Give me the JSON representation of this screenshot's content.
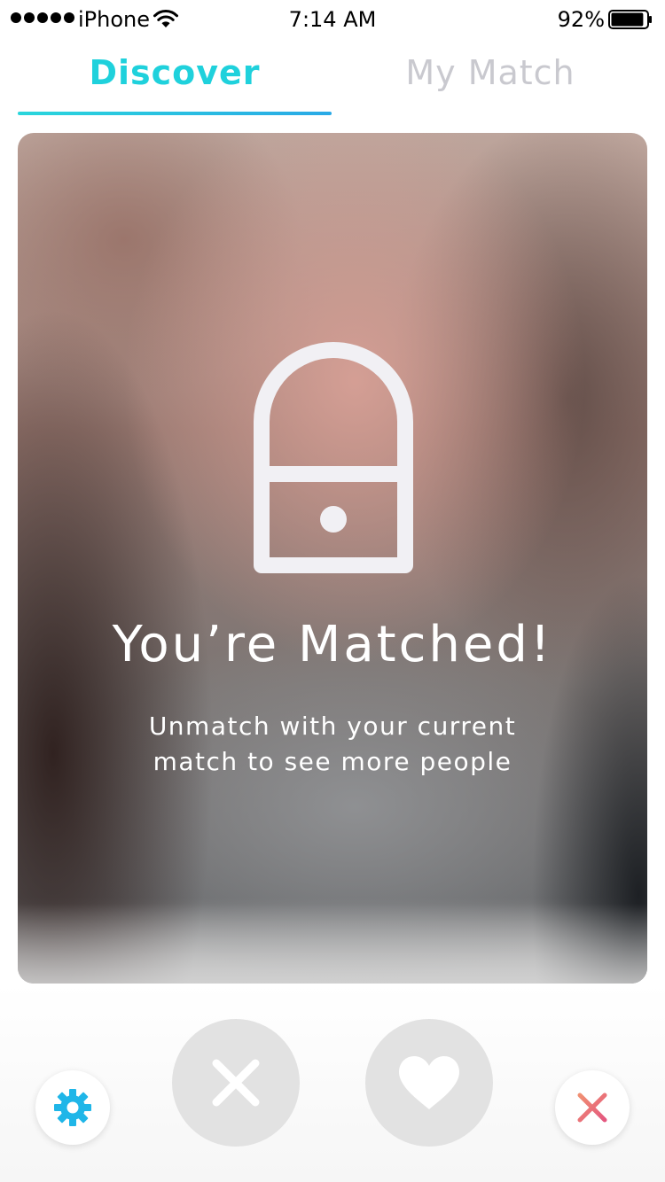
{
  "status_bar": {
    "carrier": "iPhone",
    "time": "7:14 AM",
    "battery_percent": "92%",
    "battery_level": 0.92,
    "signal_bars": 5,
    "icons": [
      "signal-dots-icon",
      "wifi-icon",
      "battery-icon"
    ]
  },
  "tabs": [
    {
      "label": "Discover",
      "active": true
    },
    {
      "label": "My Match",
      "active": false
    }
  ],
  "card": {
    "icon": "lock-icon",
    "title": "You’re Matched!",
    "subtitle": "Unmatch with your current match to see more people"
  },
  "actions": {
    "settings_icon": "gear-icon",
    "pass_icon": "x-icon",
    "like_icon": "heart-icon",
    "close_icon": "close-icon"
  },
  "colors": {
    "accent": "#1fd1dc",
    "accent_gradient_end": "#2aa9e6",
    "inactive_tab": "#c9c9cf",
    "action_disabled": "#e2e2e2",
    "close_red": "#e96a7a"
  }
}
